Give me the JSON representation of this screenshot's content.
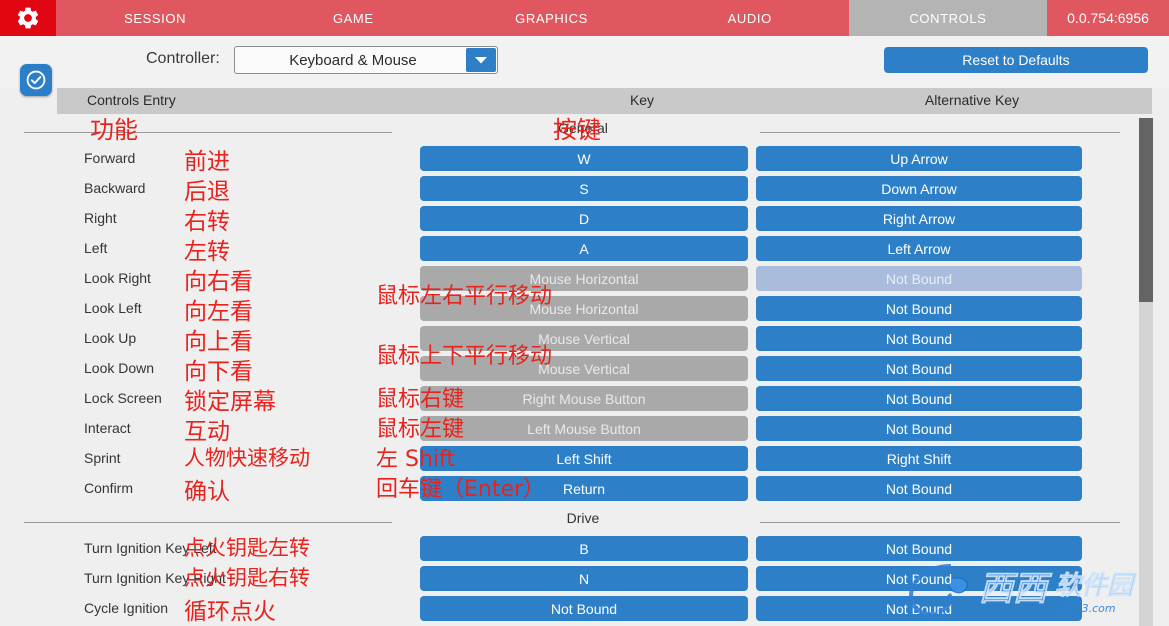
{
  "header": {
    "gear_icon": "gear-icon",
    "tabs": [
      {
        "label": "SESSION",
        "active": false
      },
      {
        "label": "GAME",
        "active": false
      },
      {
        "label": "GRAPHICS",
        "active": false
      },
      {
        "label": "AUDIO",
        "active": false
      },
      {
        "label": "CONTROLS",
        "active": true
      }
    ],
    "version": "0.0.754:6956",
    "tab_bg": "#e0575f",
    "tab_active_bg": "#b4b4b4",
    "gear_bg": "#e20613"
  },
  "toolbar": {
    "controller_label": "Controller:",
    "controller_value": "Keyboard & Mouse",
    "controller_options": [
      "Keyboard & Mouse"
    ],
    "reset_label": "Reset to Defaults",
    "check_badge_icon": "check-circle-icon",
    "accent": "#2d80c8"
  },
  "columns": {
    "entry": "Controls Entry",
    "key": "Key",
    "alt": "Alternative Key"
  },
  "annotations": {
    "entry_col": "功能",
    "key_col": "按键"
  },
  "sections": [
    {
      "title": "General",
      "rows": [
        {
          "label": "Forward",
          "anno": "前进",
          "key": {
            "text": "W",
            "state": "on"
          },
          "alt": {
            "text": "Up Arrow",
            "state": "on"
          }
        },
        {
          "label": "Backward",
          "anno": "后退",
          "key": {
            "text": "S",
            "state": "on"
          },
          "alt": {
            "text": "Down Arrow",
            "state": "on"
          }
        },
        {
          "label": "Right",
          "anno": "右转",
          "key": {
            "text": "D",
            "state": "on"
          },
          "alt": {
            "text": "Right Arrow",
            "state": "on"
          }
        },
        {
          "label": "Left",
          "anno": "左转",
          "key": {
            "text": "A",
            "state": "on"
          },
          "alt": {
            "text": "Left Arrow",
            "state": "on"
          }
        },
        {
          "label": "Look Right",
          "anno": "向右看",
          "key": {
            "text": "Mouse Horizontal",
            "state": "disabled"
          },
          "alt": {
            "text": "Not Bound",
            "state": "highlight"
          },
          "key_anno": "鼠标左右平行移动"
        },
        {
          "label": "Look Left",
          "anno": "向左看",
          "key": {
            "text": "Mouse Horizontal",
            "state": "disabled"
          },
          "alt": {
            "text": "Not Bound",
            "state": "on"
          }
        },
        {
          "label": "Look Up",
          "anno": "向上看",
          "key": {
            "text": "Mouse Vertical",
            "state": "disabled"
          },
          "alt": {
            "text": "Not Bound",
            "state": "on"
          },
          "key_anno": "鼠标上下平行移动"
        },
        {
          "label": "Look Down",
          "anno": "向下看",
          "key": {
            "text": "Mouse Vertical",
            "state": "disabled"
          },
          "alt": {
            "text": "Not Bound",
            "state": "on"
          }
        },
        {
          "label": "Lock Screen",
          "anno": "锁定屏幕",
          "key": {
            "text": "Right Mouse Button",
            "state": "disabled"
          },
          "alt": {
            "text": "Not Bound",
            "state": "on"
          },
          "key_anno": "鼠标右键"
        },
        {
          "label": "Interact",
          "anno": "互动",
          "key": {
            "text": "Left Mouse Button",
            "state": "disabled"
          },
          "alt": {
            "text": "Not Bound",
            "state": "on"
          },
          "key_anno": "鼠标左键"
        },
        {
          "label": "Sprint",
          "anno": "人物快速移动",
          "key": {
            "text": "Left Shift",
            "state": "on"
          },
          "alt": {
            "text": "Right Shift",
            "state": "on"
          },
          "key_anno": "左 Shift"
        },
        {
          "label": "Confirm",
          "anno": "确认",
          "key": {
            "text": "Return",
            "state": "on"
          },
          "alt": {
            "text": "Not Bound",
            "state": "on"
          },
          "key_anno": "回车键（Enter）"
        }
      ]
    },
    {
      "title": "Drive",
      "rows": [
        {
          "label": "Turn Ignition Key Left",
          "anno": "点火钥匙左转",
          "key": {
            "text": "B",
            "state": "on"
          },
          "alt": {
            "text": "Not Bound",
            "state": "on"
          }
        },
        {
          "label": "Turn Ignition Key Right",
          "anno": "点火钥匙右转",
          "key": {
            "text": "N",
            "state": "on"
          },
          "alt": {
            "text": "Not Bound",
            "state": "on"
          }
        },
        {
          "label": "Cycle Ignition",
          "anno": "循环点火",
          "key": {
            "text": "Not Bound",
            "state": "on"
          },
          "alt": {
            "text": "Not Bound",
            "state": "on"
          }
        }
      ]
    }
  ],
  "scrollbar": {
    "thumb_top": 0,
    "thumb_height": 184
  },
  "watermark": {
    "brand": "西西软件园",
    "site": "cr173.com"
  }
}
